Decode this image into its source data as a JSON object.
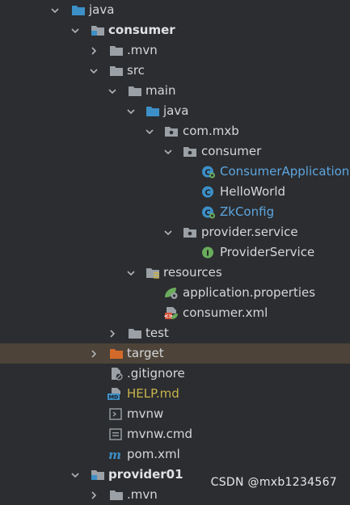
{
  "tree": [
    {
      "label": "java",
      "expanded": true,
      "icon": "folder-blue-icon"
    },
    {
      "label": "consumer",
      "expanded": true,
      "icon": "module-folder-icon"
    },
    {
      "label": ".mvn",
      "expanded": false,
      "icon": "folder-grey-icon"
    },
    {
      "label": "src",
      "expanded": true,
      "icon": "folder-grey-icon"
    },
    {
      "label": "main",
      "expanded": true,
      "icon": "folder-grey-icon"
    },
    {
      "label": "java",
      "expanded": true,
      "icon": "folder-blue-icon"
    },
    {
      "label": "com.mxb",
      "expanded": true,
      "icon": "package-icon"
    },
    {
      "label": "consumer",
      "expanded": true,
      "icon": "package-icon"
    },
    {
      "label": "ConsumerApplication",
      "icon": "spring-class-icon"
    },
    {
      "label": "HelloWorld",
      "icon": "class-icon"
    },
    {
      "label": "ZkConfig",
      "icon": "spring-class-icon"
    },
    {
      "label": "provider.service",
      "expanded": true,
      "icon": "package-icon"
    },
    {
      "label": "ProviderService",
      "icon": "interface-icon"
    },
    {
      "label": "resources",
      "expanded": true,
      "icon": "resources-folder-icon"
    },
    {
      "label": "application.properties",
      "icon": "spring-properties-icon"
    },
    {
      "label": "consumer.xml",
      "icon": "spring-xml-icon"
    },
    {
      "label": "test",
      "expanded": false,
      "icon": "folder-grey-icon"
    },
    {
      "label": "target",
      "expanded": false,
      "icon": "folder-orange-icon"
    },
    {
      "label": ".gitignore",
      "icon": "gitignore-file-icon"
    },
    {
      "label": "HELP.md",
      "icon": "markdown-file-icon"
    },
    {
      "label": "mvnw",
      "icon": "shell-file-icon"
    },
    {
      "label": "mvnw.cmd",
      "icon": "text-file-icon"
    },
    {
      "label": "pom.xml",
      "icon": "maven-pom-icon"
    },
    {
      "label": "provider01",
      "expanded": true,
      "icon": "module-folder-icon"
    },
    {
      "label": ".mvn",
      "expanded": false,
      "icon": "folder-grey-icon"
    }
  ],
  "watermark": "CSDN @mxb1234567",
  "colors": {
    "background": "#2b2d30",
    "selection": "#4d4338",
    "text": "#d4d6da",
    "link": "#5ea6e0",
    "modified": "#c8b44c",
    "folder_blue": "#3d8fc7",
    "folder_grey": "#9aa0a6",
    "folder_orange": "#d46a2a"
  }
}
